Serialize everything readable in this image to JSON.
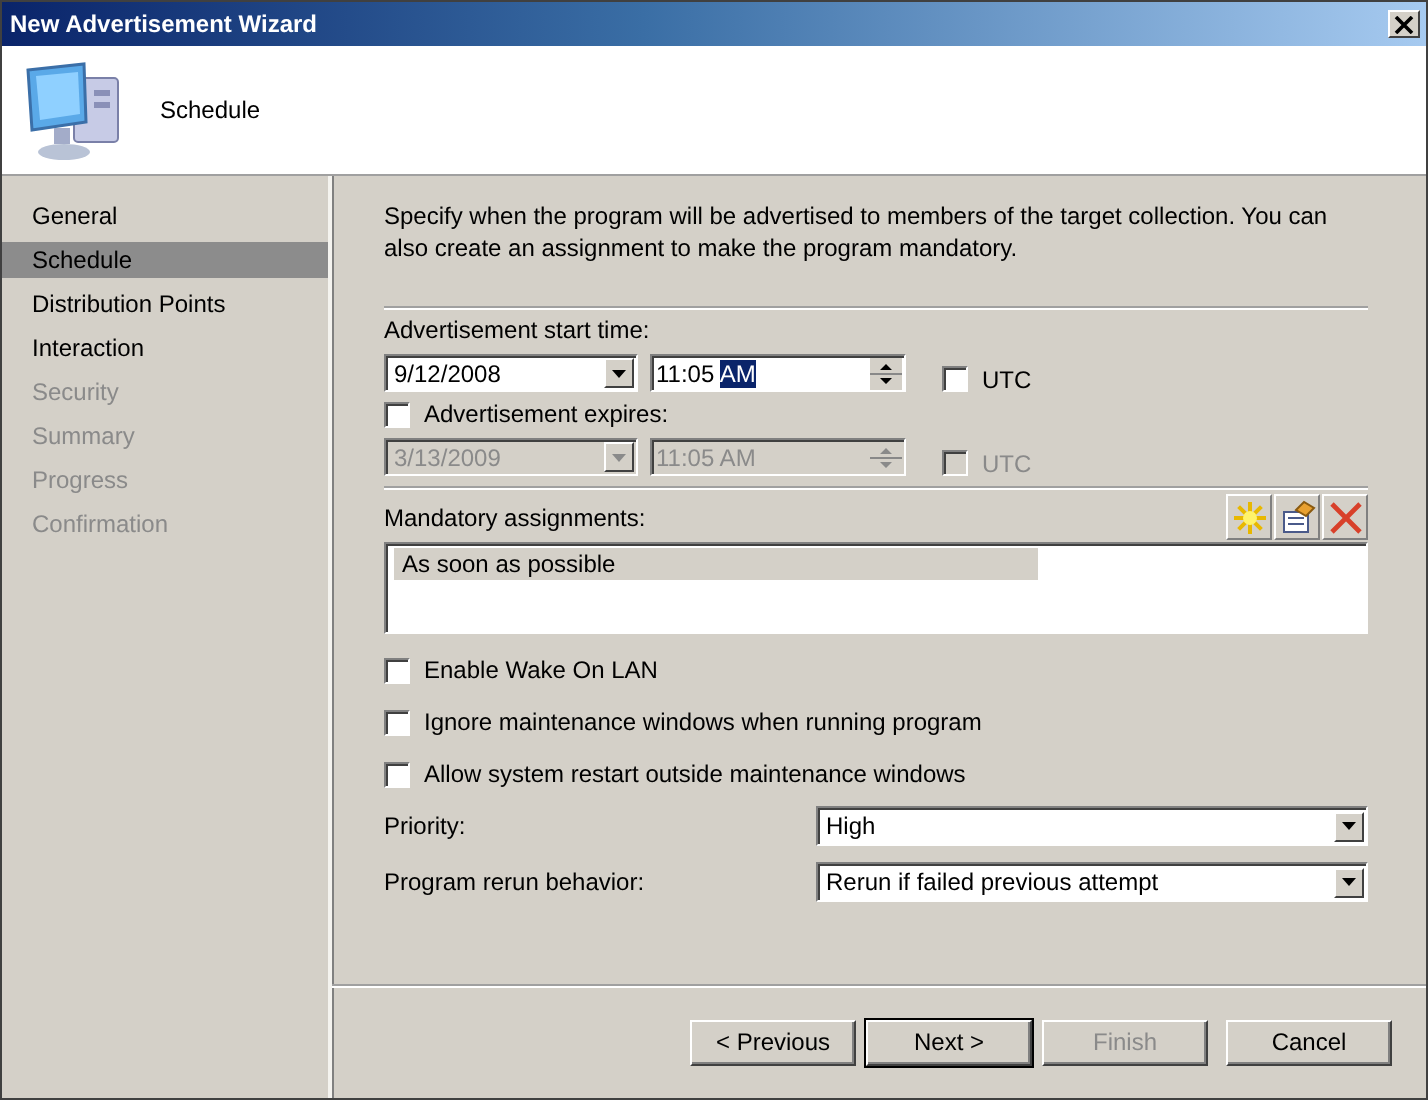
{
  "window": {
    "title": "New Advertisement Wizard"
  },
  "header": {
    "title": "Schedule"
  },
  "steps": [
    {
      "label": "General",
      "selected": false,
      "disabled": false
    },
    {
      "label": "Schedule",
      "selected": true,
      "disabled": false
    },
    {
      "label": "Distribution Points",
      "selected": false,
      "disabled": false
    },
    {
      "label": "Interaction",
      "selected": false,
      "disabled": false
    },
    {
      "label": "Security",
      "selected": false,
      "disabled": true
    },
    {
      "label": "Summary",
      "selected": false,
      "disabled": true
    },
    {
      "label": "Progress",
      "selected": false,
      "disabled": true
    },
    {
      "label": "Confirmation",
      "selected": false,
      "disabled": true
    }
  ],
  "intro": "Specify when the program will be advertised to members of the target collection. You can also create an assignment to make the program mandatory.",
  "start": {
    "label": "Advertisement start time:",
    "date": "9/12/2008",
    "time": "11:05",
    "time_selection": "AM",
    "utc": {
      "label": "UTC",
      "checked": false
    }
  },
  "expires": {
    "label": "Advertisement expires:",
    "checked": false,
    "date": "3/13/2009",
    "time": "11:05 AM",
    "utc": {
      "label": "UTC",
      "checked": false
    }
  },
  "mandatory": {
    "label": "Mandatory assignments:",
    "items": [
      {
        "label": "As soon as possible",
        "selected": true
      }
    ]
  },
  "options": [
    {
      "label": "Enable Wake On LAN",
      "checked": false
    },
    {
      "label": "Ignore maintenance windows when running program",
      "checked": false
    },
    {
      "label": "Allow system restart outside maintenance windows",
      "checked": false
    }
  ],
  "priority": {
    "label": "Priority:",
    "value": "High"
  },
  "rerun": {
    "label": "Program rerun behavior:",
    "value": "Rerun if failed previous attempt"
  },
  "buttons": [
    {
      "label": "< Previous",
      "disabled": false,
      "default": false
    },
    {
      "label": "Next >",
      "disabled": false,
      "default": true
    },
    {
      "label": "Finish",
      "disabled": true,
      "default": false
    },
    {
      "label": "Cancel",
      "disabled": false,
      "default": false
    }
  ]
}
